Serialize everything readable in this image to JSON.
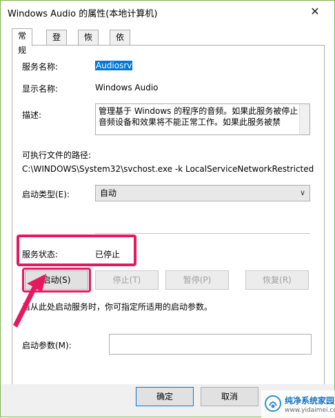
{
  "window": {
    "title": "Windows Audio 的属性(本地计算机)",
    "close_glyph": "✕"
  },
  "tabs": [
    {
      "label": "常规"
    },
    {
      "label": "登录"
    },
    {
      "label": "恢复"
    },
    {
      "label": "依存关系"
    }
  ],
  "general": {
    "service_name_label": "服务名称:",
    "service_name_value": "Audiosrv",
    "display_name_label": "显示名称:",
    "display_name_value": "Windows Audio",
    "description_label": "描述:",
    "description_value": "管理基于 Windows 的程序的音频。如果此服务被停止，音频设备和效果将不能正常工作。如果此服务被禁",
    "path_label": "可执行文件的路径:",
    "path_value": "C:\\WINDOWS\\System32\\svchost.exe -k LocalServiceNetworkRestricted",
    "startup_type_label": "启动类型(E):",
    "startup_type_value": "自动",
    "status_label": "服务状态:",
    "status_value": "已停止",
    "buttons": {
      "start": "启动(S)",
      "stop": "停止(T)",
      "pause": "暂停(P)",
      "resume": "恢复(R)"
    },
    "hint_text": "当从此处启动服务时，你可指定所适用的启动参数。",
    "start_params_label": "启动参数(M):",
    "start_params_value": ""
  },
  "footer": {
    "ok": "确定",
    "cancel": "取消"
  },
  "watermark": {
    "line1": "纯净系统家园",
    "line2": "www.yidaimei.com"
  },
  "colors": {
    "highlight": "#e8185f",
    "selection": "#0078d7",
    "frame": "#7ab34b"
  }
}
